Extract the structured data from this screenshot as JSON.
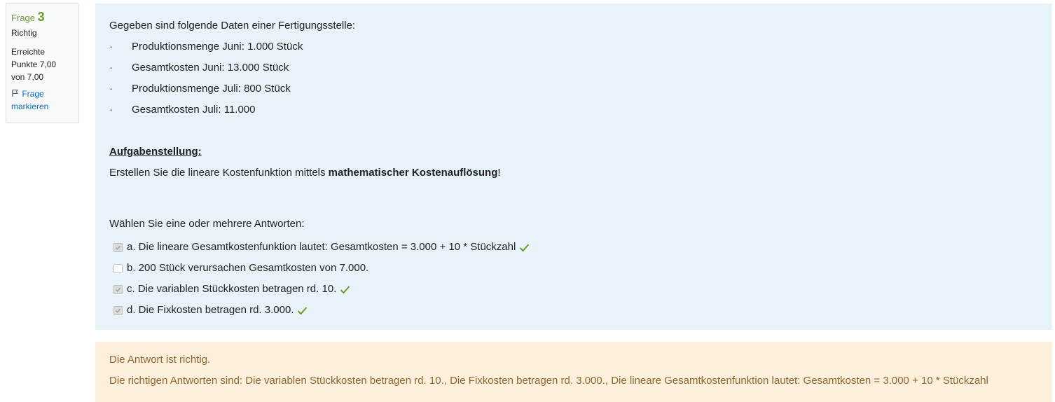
{
  "info": {
    "question_label": "Frage",
    "question_number": "3",
    "state": "Richtig",
    "grade_line1": "Erreichte",
    "grade_line2": "Punkte 7,00",
    "grade_line3": "von 7,00",
    "flag_line1": "Frage",
    "flag_line2": "markieren"
  },
  "question": {
    "intro": "Gegeben sind folgende Daten einer Fertigungsstelle:",
    "bullet_symbol": "·",
    "bullets": [
      "Produktionsmenge Juni: 1.000 Stück",
      "Gesamtkosten Juni: 13.000 Stück",
      "Produktionsmenge Juli: 800 Stück",
      "Gesamtkosten Juli: 11.000"
    ],
    "task_heading": "Aufgabenstellung:",
    "task_before": "Erstellen Sie die lineare Kostenfunktion mittels ",
    "task_bold": "mathematischer Kostenauflösung",
    "task_after": "!",
    "prompt": "Wählen Sie eine oder mehrere Antworten:"
  },
  "answers": [
    {
      "label": "a. Die lineare Gesamtkostenfunktion lautet: Gesamtkosten = 3.000 + 10 * Stückzahl",
      "checked": true,
      "correct": true
    },
    {
      "label": "b. 200 Stück verursachen Gesamtkosten von 7.000.",
      "checked": false,
      "correct": false
    },
    {
      "label": "c. Die variablen Stückkosten betragen rd. 10.",
      "checked": true,
      "correct": true
    },
    {
      "label": "d. Die Fixkosten betragen rd. 3.000.",
      "checked": true,
      "correct": true
    }
  ],
  "feedback": {
    "result": "Die Antwort ist richtig.",
    "right_answers": "Die richtigen Antworten sind: Die variablen Stückkosten betragen rd. 10., Die Fixkosten betragen rd. 3.000., Die lineare Gesamtkostenfunktion lautet: Gesamtkosten = 3.000 + 10 * Stückzahl"
  },
  "colors": {
    "content_bg": "#e7f3f9",
    "feedback_bg": "#fcefdc",
    "feedback_text": "#8e662e",
    "correct_green": "#6a9b2c",
    "link_blue": "#0f6cbf"
  }
}
